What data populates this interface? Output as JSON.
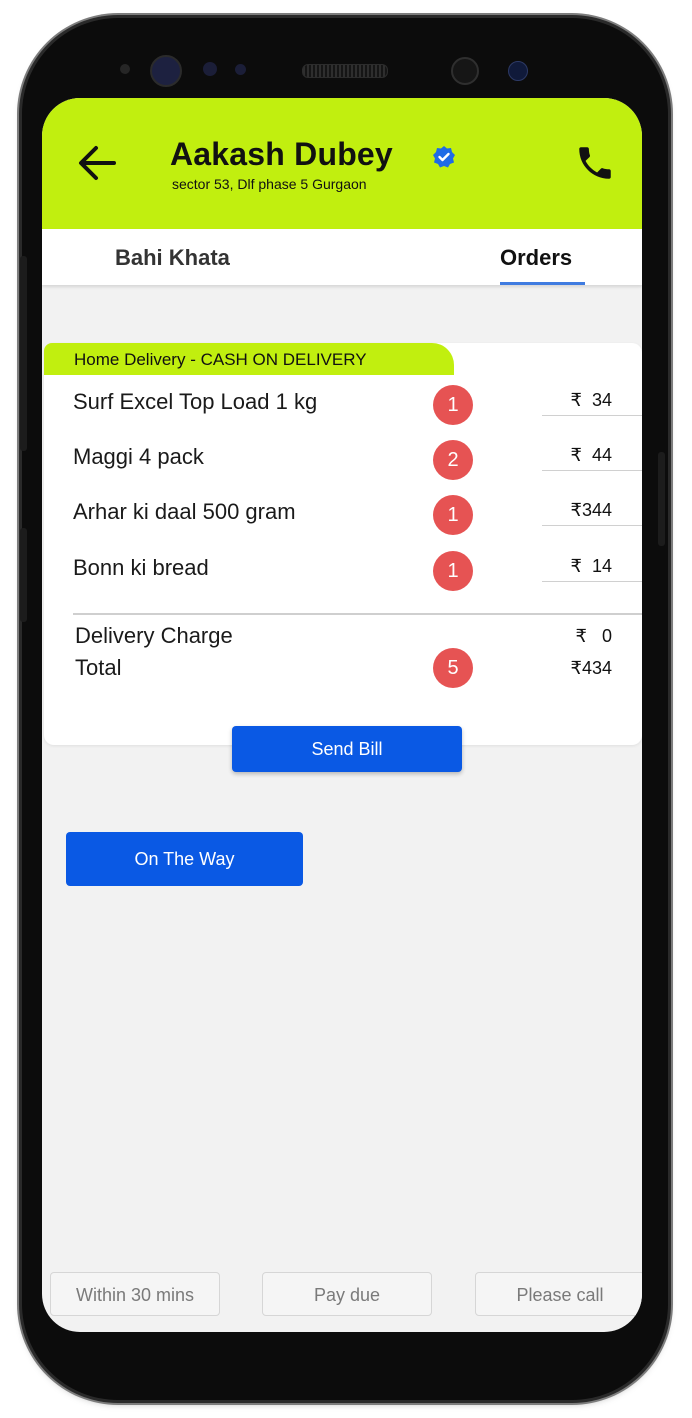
{
  "header": {
    "contact_name": "Aakash Dubey",
    "address": "sector 53, Dlf phase 5 Gurgaon",
    "accent_color": "#c1ef0f",
    "icons": [
      "back-arrow-icon",
      "verified-badge-icon",
      "phone-icon"
    ]
  },
  "tabs": [
    {
      "label": "Bahi Khata",
      "active": false
    },
    {
      "label": "Orders",
      "active": true
    }
  ],
  "order": {
    "delivery_tag": "Home Delivery  - CASH ON DELIVERY",
    "currency": "₹",
    "items": [
      {
        "name": "Surf Excel Top Load 1 kg",
        "qty": "1",
        "price": "34"
      },
      {
        "name": "Maggi 4 pack",
        "qty": "2",
        "price": "44"
      },
      {
        "name": "Arhar ki daal 500 gram",
        "qty": "1",
        "price": "344"
      },
      {
        "name": "Bonn ki bread",
        "qty": "1",
        "price": "14"
      }
    ],
    "delivery_charge_label": "Delivery Charge",
    "delivery_charge_value": "0",
    "total_label": "Total",
    "total_qty": "5",
    "total_value": "434"
  },
  "buttons": {
    "send_bill": "Send Bill",
    "on_the_way": "On The Way",
    "primary_color": "#0a59e4"
  },
  "quick_replies": [
    "Within 30 mins",
    "Pay due",
    "Please call"
  ],
  "badge_color": "#e65353"
}
